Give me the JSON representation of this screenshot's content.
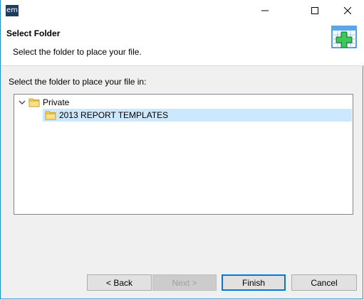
{
  "window": {
    "app_icon_text": "em",
    "controls": {
      "minimize": "—",
      "maximize": "☐",
      "close": "✕"
    }
  },
  "header": {
    "title": "Select Folder",
    "subtitle": "Select the folder to place your file.",
    "icon": "new-folder-plus-icon"
  },
  "body": {
    "prompt": "Select the folder to place your file in:"
  },
  "tree": {
    "items": [
      {
        "label": "Private",
        "expanded": true,
        "icon": "folder-icon"
      },
      {
        "label": "2013 REPORT TEMPLATES",
        "selected": true,
        "icon": "folder-icon"
      }
    ]
  },
  "buttons": {
    "back": "< Back",
    "next": "Next >",
    "finish": "Finish",
    "cancel": "Cancel"
  },
  "colors": {
    "accent": "#0078d7",
    "selection": "#cce8ff",
    "folder": "#f5d55c",
    "window_border": "#1e8fc6"
  }
}
